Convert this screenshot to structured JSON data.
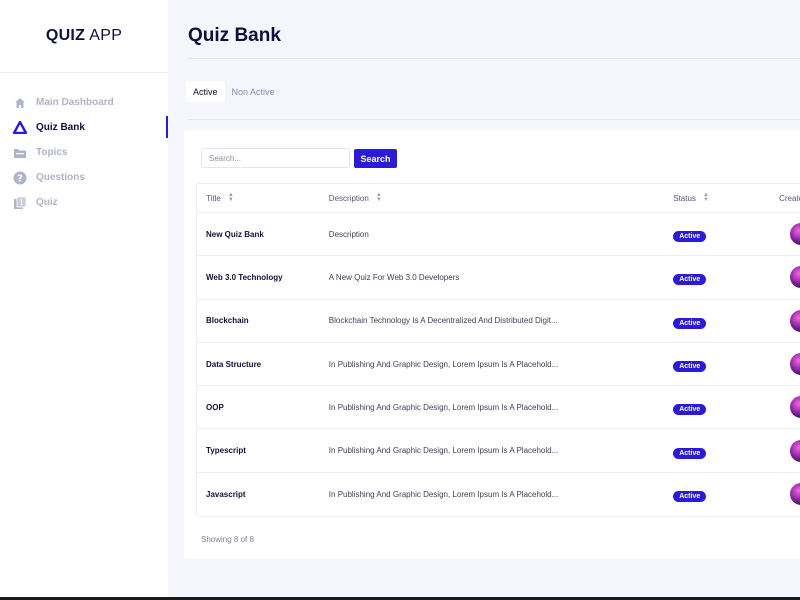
{
  "app": {
    "logo_bold": "QUIZ",
    "logo_rest": "APP"
  },
  "sidebar": {
    "items": [
      {
        "label": "Main Dashboard",
        "icon": "home-icon",
        "active": false
      },
      {
        "label": "Quiz Bank",
        "icon": "bank-icon",
        "active": true
      },
      {
        "label": "Topics",
        "icon": "folder-icon",
        "active": false
      },
      {
        "label": "Questions",
        "icon": "question-icon",
        "active": false
      },
      {
        "label": "Quiz",
        "icon": "quiz-icon",
        "active": false
      }
    ]
  },
  "page": {
    "title": "Quiz Bank"
  },
  "tabs": [
    {
      "label": "Active",
      "active": true
    },
    {
      "label": "Non Active",
      "active": false
    }
  ],
  "search": {
    "placeholder": "Search...",
    "value": "",
    "button_label": "Search"
  },
  "table": {
    "headers": {
      "title": "Title",
      "description": "Description",
      "status": "Status",
      "created": "Created By"
    },
    "rows": [
      {
        "title": "New Quiz Bank",
        "description": "Description",
        "status": "Active"
      },
      {
        "title": "Web 3.0 Technology",
        "description": "A New Quiz For Web 3.0 Developers",
        "status": "Active"
      },
      {
        "title": "Blockchain",
        "description": "Blockchain Technology Is A Decentralized And Distributed Digit...",
        "status": "Active"
      },
      {
        "title": "Data Structure",
        "description": "In Publishing And Graphic Design, Lorem Ipsum Is A Placehold...",
        "status": "Active"
      },
      {
        "title": "OOP",
        "description": "In Publishing And Graphic Design, Lorem Ipsum Is A Placehold...",
        "status": "Active"
      },
      {
        "title": "Typescript",
        "description": "In Publishing And Graphic Design, Lorem Ipsum Is A Placehold...",
        "status": "Active"
      },
      {
        "title": "Javascript",
        "description": "In Publishing And Graphic Design, Lorem Ipsum Is A Placehold...",
        "status": "Active"
      }
    ]
  },
  "footer": {
    "showing": "Showing 8 of 8"
  },
  "colors": {
    "accent": "#2a1bd6",
    "navy": "#10103a",
    "muted": "#b0b4c8",
    "background": "#f5f6fb"
  }
}
